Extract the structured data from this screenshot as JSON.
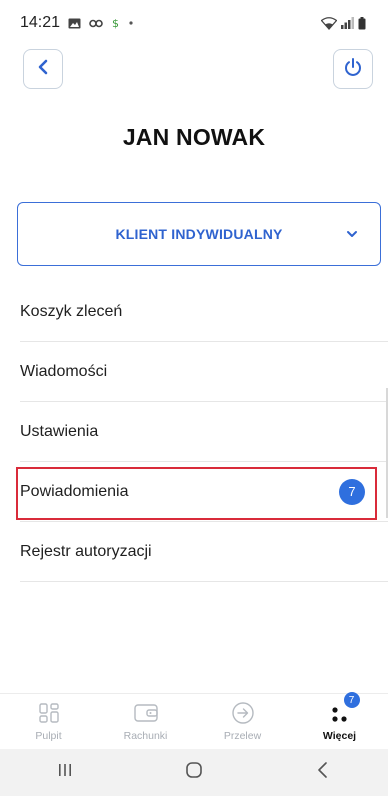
{
  "status_bar": {
    "time": "14:21"
  },
  "header": {
    "user_name": "JAN NOWAK"
  },
  "client_select": {
    "selected": "KLIENT INDYWIDUALNY"
  },
  "menu": {
    "items": [
      {
        "label": "Koszyk zleceń"
      },
      {
        "label": "Wiadomości"
      },
      {
        "label": "Ustawienia"
      },
      {
        "label": "Powiadomienia",
        "badge": "7"
      },
      {
        "label": "Rejestr autoryzacji"
      }
    ]
  },
  "tabs": [
    {
      "label": "Pulpit",
      "icon": "grid-icon",
      "active": false
    },
    {
      "label": "Rachunki",
      "icon": "wallet-icon",
      "active": false
    },
    {
      "label": "Przelew",
      "icon": "arrow-circle-icon",
      "active": false
    },
    {
      "label": "Więcej",
      "icon": "dots-icon",
      "active": true,
      "badge": "7"
    }
  ],
  "colors": {
    "accent": "#2f63cf",
    "badge": "#2f6fde",
    "highlight": "#d92b3a",
    "border": "#c9d3de"
  }
}
